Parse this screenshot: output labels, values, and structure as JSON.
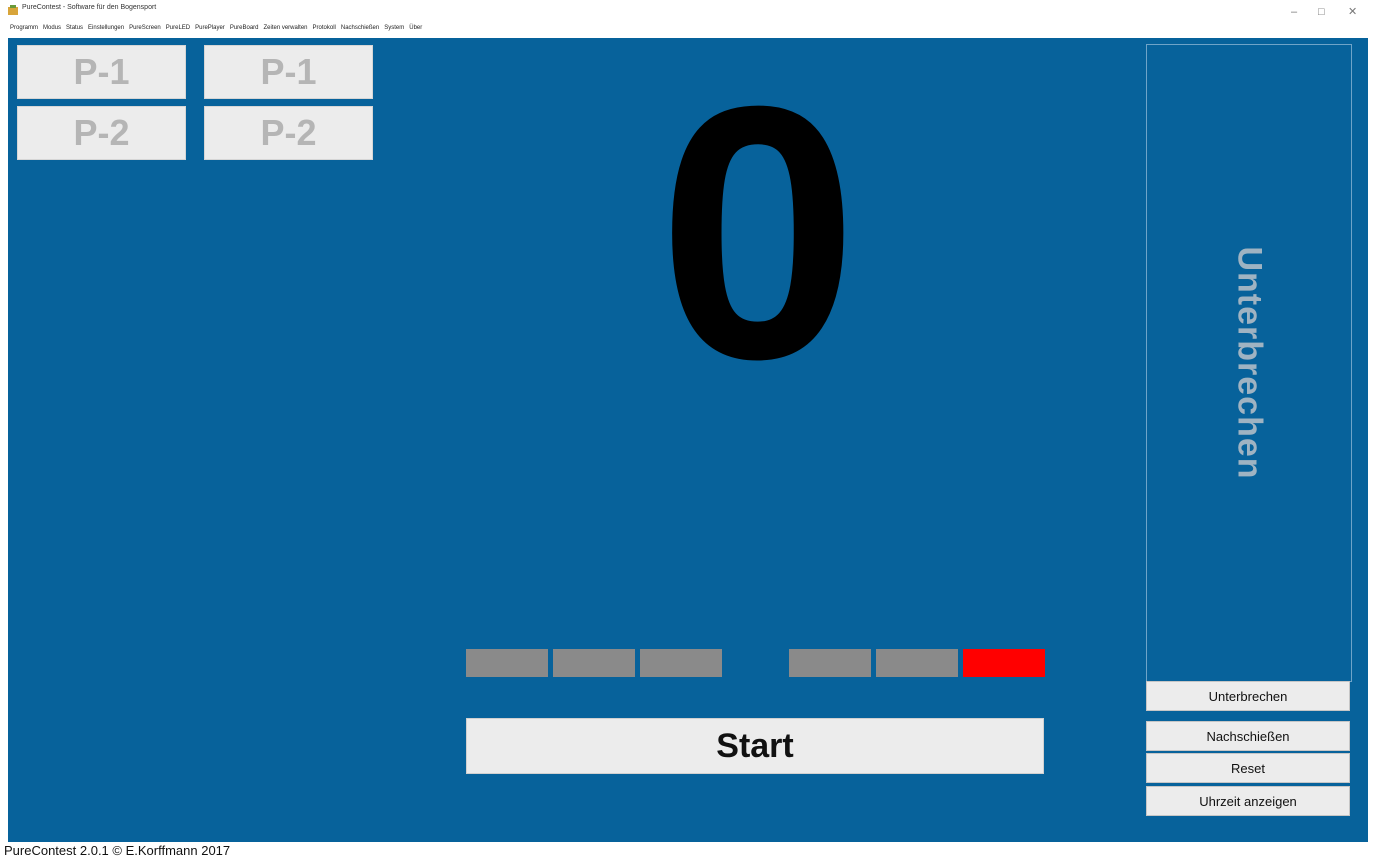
{
  "window": {
    "title": "PureContest - Software für den Bogensport",
    "icon": "app-icon",
    "controls": {
      "minimize": "–",
      "maximize": "□",
      "close": "✕"
    }
  },
  "menu": [
    "Programm",
    "Modus",
    "Status",
    "Einstellungen",
    "PureScreen",
    "PureLED",
    "PurePlayer",
    "PureBoard",
    "Zeiten verwalten",
    "Protokoll",
    "Nachschießen",
    "System",
    "Über"
  ],
  "players": {
    "left": [
      "P-1",
      "P-2"
    ],
    "right": [
      "P-1",
      "P-2"
    ]
  },
  "counter": "0",
  "indicators": {
    "colors": [
      "#8a8a8a",
      "#8a8a8a",
      "#8a8a8a",
      "#8a8a8a",
      "#8a8a8a",
      "#ff0000"
    ]
  },
  "buttons": {
    "start": "Start",
    "unterbrechen_big": "Unterbrechen",
    "unterbrechen": "Unterbrechen",
    "nachschiessen": "Nachschießen",
    "reset": "Reset",
    "uhrzeit": "Uhrzeit anzeigen"
  },
  "colors": {
    "background": "#07629b",
    "button": "#ececec",
    "active_indicator": "#ff0000"
  },
  "status": "PureContest 2.0.1 © E.Korffmann 2017"
}
